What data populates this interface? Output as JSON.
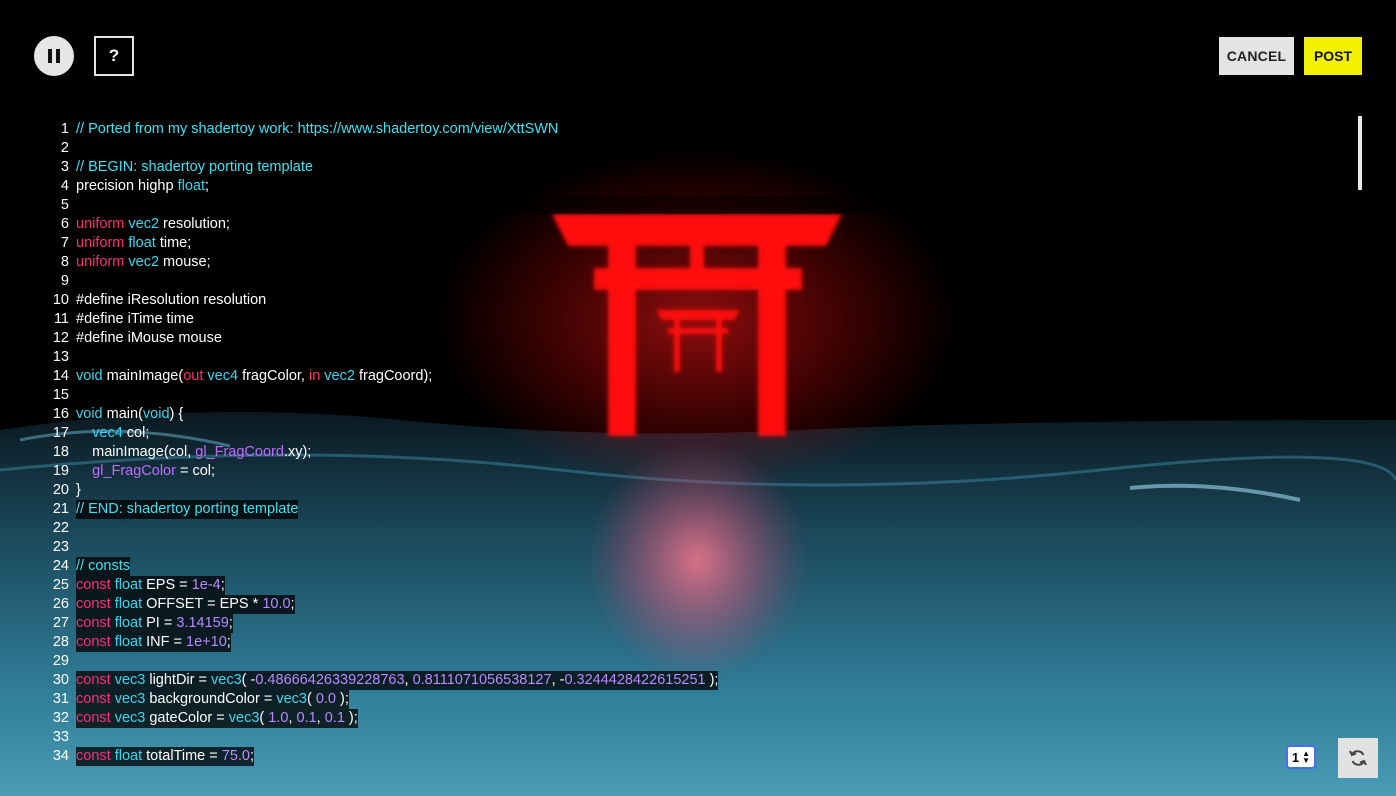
{
  "toolbar": {
    "pause_icon": "pause-icon",
    "help_label": "?",
    "cancel_label": "CANCEL",
    "post_label": "POST",
    "post_color": "#f2f200"
  },
  "editor": {
    "lines": [
      {
        "n": "1",
        "segs": [
          {
            "t": "// Ported from my shadertoy work: https://www.shadertoy.com/view/XttSWN",
            "c": "comment"
          }
        ]
      },
      {
        "n": "2",
        "segs": []
      },
      {
        "n": "3",
        "segs": [
          {
            "t": "// BEGIN: shadertoy porting template",
            "c": "comment"
          }
        ]
      },
      {
        "n": "4",
        "segs": [
          {
            "t": "precision highp ",
            "c": "plain"
          },
          {
            "t": "float",
            "c": "type"
          },
          {
            "t": ";",
            "c": "plain"
          }
        ]
      },
      {
        "n": "5",
        "segs": []
      },
      {
        "n": "6",
        "segs": [
          {
            "t": "uniform ",
            "c": "kw"
          },
          {
            "t": "vec2",
            "c": "type"
          },
          {
            "t": " resolution;",
            "c": "plain"
          }
        ]
      },
      {
        "n": "7",
        "segs": [
          {
            "t": "uniform ",
            "c": "kw"
          },
          {
            "t": "float",
            "c": "type"
          },
          {
            "t": " time;",
            "c": "plain"
          }
        ]
      },
      {
        "n": "8",
        "segs": [
          {
            "t": "uniform ",
            "c": "kw"
          },
          {
            "t": "vec2",
            "c": "type"
          },
          {
            "t": " mouse;",
            "c": "plain"
          }
        ]
      },
      {
        "n": "9",
        "segs": []
      },
      {
        "n": "10",
        "segs": [
          {
            "t": "#define iResolution resolution",
            "c": "plain"
          }
        ]
      },
      {
        "n": "11",
        "segs": [
          {
            "t": "#define iTime time",
            "c": "plain"
          }
        ]
      },
      {
        "n": "12",
        "segs": [
          {
            "t": "#define iMouse mouse",
            "c": "plain"
          }
        ]
      },
      {
        "n": "13",
        "segs": []
      },
      {
        "n": "14",
        "segs": [
          {
            "t": "void",
            "c": "type"
          },
          {
            "t": " mainImage(",
            "c": "plain"
          },
          {
            "t": "out",
            "c": "kw"
          },
          {
            "t": " ",
            "c": "plain"
          },
          {
            "t": "vec4",
            "c": "type"
          },
          {
            "t": " fragColor, ",
            "c": "plain"
          },
          {
            "t": "in",
            "c": "kw"
          },
          {
            "t": " ",
            "c": "plain"
          },
          {
            "t": "vec2",
            "c": "type"
          },
          {
            "t": " fragCoord);",
            "c": "plain"
          }
        ]
      },
      {
        "n": "15",
        "segs": []
      },
      {
        "n": "16",
        "segs": [
          {
            "t": "void",
            "c": "type"
          },
          {
            "t": " main(",
            "c": "plain"
          },
          {
            "t": "void",
            "c": "type"
          },
          {
            "t": ") {",
            "c": "plain"
          }
        ]
      },
      {
        "n": "17",
        "segs": [
          {
            "t": "    ",
            "c": "plain"
          },
          {
            "t": "vec4",
            "c": "type"
          },
          {
            "t": " col;",
            "c": "plain"
          }
        ]
      },
      {
        "n": "18",
        "segs": [
          {
            "t": "    mainImage(col, ",
            "c": "plain"
          },
          {
            "t": "gl_FragCoord",
            "c": "builtin"
          },
          {
            "t": ".xy);",
            "c": "plain"
          }
        ]
      },
      {
        "n": "19",
        "segs": [
          {
            "t": "    ",
            "c": "plain"
          },
          {
            "t": "gl_FragColor",
            "c": "builtin"
          },
          {
            "t": " = col;",
            "c": "plain"
          }
        ]
      },
      {
        "n": "20",
        "segs": [
          {
            "t": "}",
            "c": "plain"
          }
        ]
      },
      {
        "n": "21",
        "segs": [
          {
            "t": "// END: shadertoy porting template",
            "c": "comment"
          }
        ]
      },
      {
        "n": "22",
        "segs": []
      },
      {
        "n": "23",
        "segs": []
      },
      {
        "n": "24",
        "segs": [
          {
            "t": "// consts",
            "c": "comment"
          }
        ]
      },
      {
        "n": "25",
        "segs": [
          {
            "t": "const ",
            "c": "kw"
          },
          {
            "t": "float",
            "c": "type"
          },
          {
            "t": " EPS = ",
            "c": "plain"
          },
          {
            "t": "1e-4",
            "c": "num"
          },
          {
            "t": ";",
            "c": "plain"
          }
        ]
      },
      {
        "n": "26",
        "segs": [
          {
            "t": "const ",
            "c": "kw"
          },
          {
            "t": "float",
            "c": "type"
          },
          {
            "t": " OFFSET = EPS * ",
            "c": "plain"
          },
          {
            "t": "10.0",
            "c": "num"
          },
          {
            "t": ";",
            "c": "plain"
          }
        ]
      },
      {
        "n": "27",
        "segs": [
          {
            "t": "const ",
            "c": "kw"
          },
          {
            "t": "float",
            "c": "type"
          },
          {
            "t": " PI = ",
            "c": "plain"
          },
          {
            "t": "3.14159",
            "c": "num"
          },
          {
            "t": ";",
            "c": "plain"
          }
        ]
      },
      {
        "n": "28",
        "segs": [
          {
            "t": "const ",
            "c": "kw"
          },
          {
            "t": "float",
            "c": "type"
          },
          {
            "t": " INF = ",
            "c": "plain"
          },
          {
            "t": "1e+10",
            "c": "num"
          },
          {
            "t": ";",
            "c": "plain"
          }
        ]
      },
      {
        "n": "29",
        "segs": []
      },
      {
        "n": "30",
        "segs": [
          {
            "t": "const ",
            "c": "kw"
          },
          {
            "t": "vec3",
            "c": "type"
          },
          {
            "t": " lightDir = ",
            "c": "plain"
          },
          {
            "t": "vec3",
            "c": "type"
          },
          {
            "t": "( -",
            "c": "plain"
          },
          {
            "t": "0.48666426339228763",
            "c": "num"
          },
          {
            "t": ", ",
            "c": "plain"
          },
          {
            "t": "0.8111071056538127",
            "c": "num"
          },
          {
            "t": ", -",
            "c": "plain"
          },
          {
            "t": "0.3244428422615251",
            "c": "num"
          },
          {
            "t": " );",
            "c": "plain"
          }
        ]
      },
      {
        "n": "31",
        "segs": [
          {
            "t": "const ",
            "c": "kw"
          },
          {
            "t": "vec3",
            "c": "type"
          },
          {
            "t": " backgroundColor = ",
            "c": "plain"
          },
          {
            "t": "vec3",
            "c": "type"
          },
          {
            "t": "( ",
            "c": "plain"
          },
          {
            "t": "0.0",
            "c": "num"
          },
          {
            "t": " );",
            "c": "plain"
          }
        ]
      },
      {
        "n": "32",
        "segs": [
          {
            "t": "const ",
            "c": "kw"
          },
          {
            "t": "vec3",
            "c": "type"
          },
          {
            "t": " gateColor = ",
            "c": "plain"
          },
          {
            "t": "vec3",
            "c": "type"
          },
          {
            "t": "( ",
            "c": "plain"
          },
          {
            "t": "1.0",
            "c": "num"
          },
          {
            "t": ", ",
            "c": "plain"
          },
          {
            "t": "0.1",
            "c": "num"
          },
          {
            "t": ", ",
            "c": "plain"
          },
          {
            "t": "0.1",
            "c": "num"
          },
          {
            "t": " );",
            "c": "plain"
          }
        ]
      },
      {
        "n": "33",
        "segs": []
      },
      {
        "n": "34",
        "segs": [
          {
            "t": "const ",
            "c": "kw"
          },
          {
            "t": "float",
            "c": "type"
          },
          {
            "t": " totalTime = ",
            "c": "plain"
          },
          {
            "t": "75.0",
            "c": "num"
          },
          {
            "t": ";",
            "c": "plain"
          }
        ]
      }
    ],
    "highlight_from_line": 21,
    "colors": {
      "comment": "#38e4f2",
      "keyword": "#ff2d78",
      "type": "#35d8f0",
      "number": "#b98bff",
      "builtin": "#c26bff",
      "plain": "#ffffff"
    }
  },
  "bottom": {
    "mode_value": "1",
    "reload_icon": "reload-icon"
  }
}
